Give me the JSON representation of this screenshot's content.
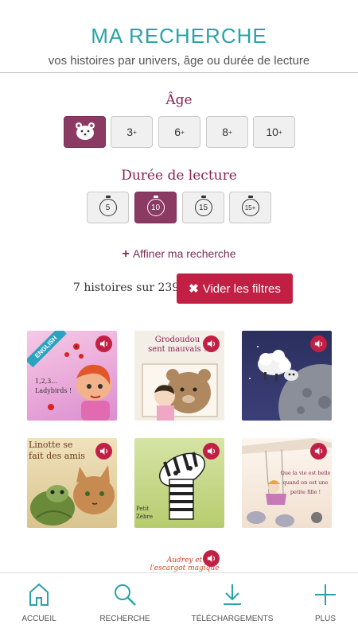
{
  "header": {
    "title": "MA RECHERCHE",
    "subtitle": "vos histoires par univers, âge ou durée de lecture"
  },
  "age": {
    "label": "Âge",
    "options": [
      {
        "label": "3",
        "sup": "+",
        "selected": false
      },
      {
        "label": "6",
        "sup": "+",
        "selected": false
      },
      {
        "label": "8",
        "sup": "+",
        "selected": false
      },
      {
        "label": "10",
        "sup": "+",
        "selected": false
      }
    ],
    "baby_selected": true,
    "baby_icon": "teddy-bear-icon"
  },
  "duration": {
    "label": "Durée de lecture",
    "options": [
      {
        "label": "5",
        "selected": false
      },
      {
        "label": "10",
        "selected": true
      },
      {
        "label": "15",
        "selected": false
      },
      {
        "label": "15+",
        "selected": false
      }
    ]
  },
  "refine": {
    "label": "Affiner ma recherche"
  },
  "results": {
    "count_text": "7 histoires sur 239",
    "clear_label": "Vider les filtres"
  },
  "stories": [
    {
      "title_text": "1,2,3... Ladybirds !",
      "badge": "ENGLISH"
    },
    {
      "title_text": "Grodoudou sent mauvais !"
    },
    {
      "title_text": ""
    },
    {
      "title_text": "Linotte se fait des amis"
    },
    {
      "title_text": "Petit Zèbre"
    },
    {
      "title_text": "Que la vie est belle quand on est une petite fille !"
    },
    {
      "title_text": "Audrey et l'escargot magique"
    }
  ],
  "nav": [
    {
      "label": "ACCUEIL",
      "icon": "home-icon"
    },
    {
      "label": "RECHERCHE",
      "icon": "search-icon"
    },
    {
      "label": "TÉLÉCHARGEMENTS",
      "icon": "download-icon"
    },
    {
      "label": "PLUS",
      "icon": "plus-icon"
    }
  ],
  "colors": {
    "accent": "#2aa3a8",
    "selected": "#8a3a63",
    "danger": "#c21f44",
    "label": "#8a2255"
  }
}
